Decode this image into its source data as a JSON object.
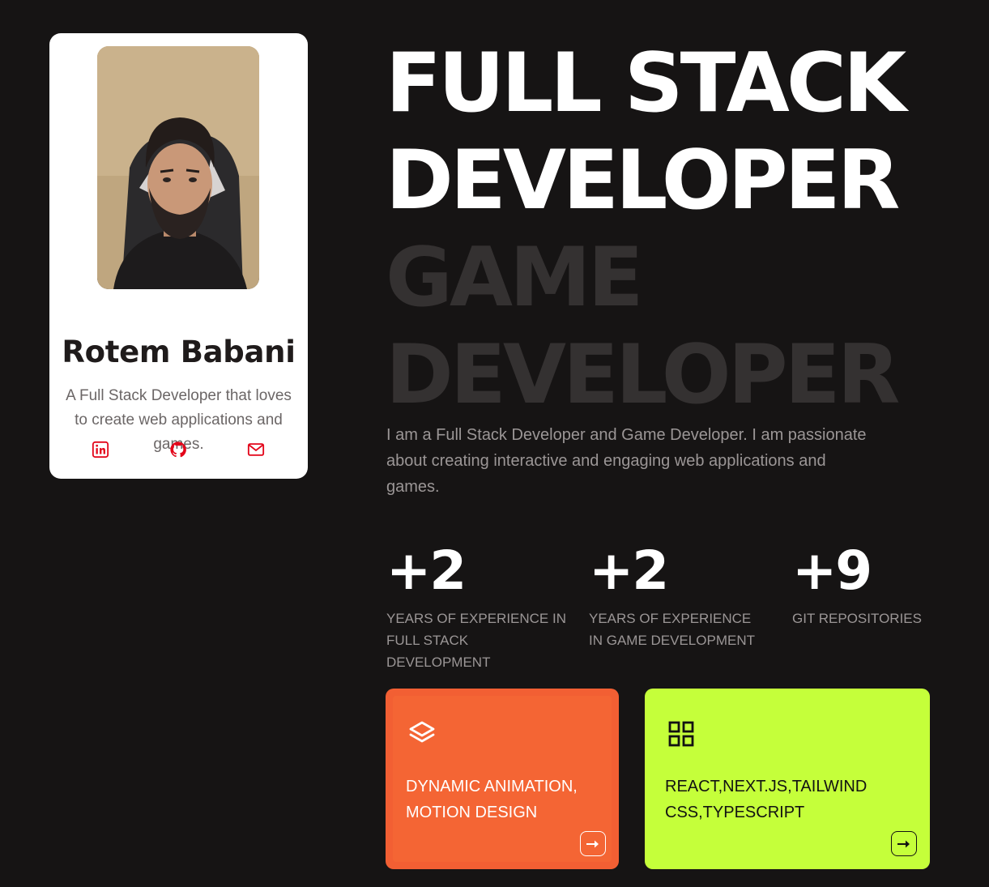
{
  "profile": {
    "name": "Rotem Babani",
    "bio": "A Full Stack Developer that loves to create web applications and games.",
    "socials": [
      {
        "icon": "linkedin-icon",
        "color": "#e3061a"
      },
      {
        "icon": "github-icon",
        "color": "#e3061a"
      },
      {
        "icon": "mail-icon",
        "color": "#e3061a"
      }
    ]
  },
  "hero": {
    "lines": [
      {
        "text": "FULL STACK",
        "tone": "light"
      },
      {
        "text": "DEVELOPER",
        "tone": "light"
      },
      {
        "text": "GAME",
        "tone": "dim"
      },
      {
        "text": "DEVELOPER",
        "tone": "dim"
      }
    ],
    "intro": "I am a Full Stack Developer and Game Developer. I am passionate about creating interactive and engaging web applications and games."
  },
  "stats": [
    {
      "value": "+2",
      "label": "YEARS OF EXPERIENCE IN FULL STACK DEVELOPMENT"
    },
    {
      "value": "+2",
      "label": "YEARS OF EXPERIENCE IN GAME DEVELOPMENT"
    },
    {
      "value": "+9",
      "label": "GIT REPOSITORIES"
    }
  ],
  "cards": [
    {
      "icon": "layers-icon",
      "title": "DYNAMIC ANIMATION, MOTION DESIGN",
      "color": "#f25f33"
    },
    {
      "icon": "grid-icon",
      "title": "REACT,NEXT.JS,TAILWIND CSS,TYPESCRIPT",
      "color": "#c5ff3a"
    }
  ],
  "colors": {
    "background": "#161414",
    "accent_red": "#e3061a",
    "orange": "#f25f33",
    "lime": "#c5ff3a"
  }
}
